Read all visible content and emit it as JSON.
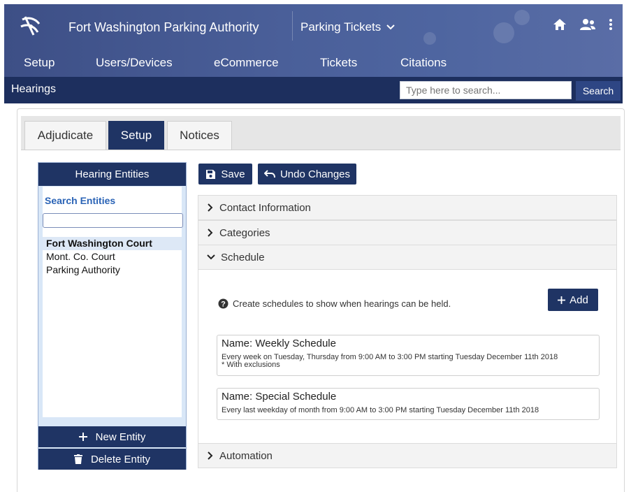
{
  "header": {
    "app_title": "Fort Washington Parking Authority",
    "module": "Parking Tickets",
    "icons": [
      "home-icon",
      "users-icon",
      "more-vertical-icon"
    ],
    "nav": [
      "Setup",
      "Users/Devices",
      "eCommerce",
      "Tickets",
      "Citations"
    ]
  },
  "subbar": {
    "title": "Hearings",
    "search_placeholder": "Type here to search...",
    "search_button": "Search"
  },
  "tabs": [
    "Adjudicate",
    "Setup",
    "Notices"
  ],
  "active_tab": "Setup",
  "entities": {
    "title": "Hearing Entities",
    "search_label": "Search Entities",
    "search_value": "",
    "items": [
      "Fort Washington Court",
      "Mont. Co. Court",
      "Parking Authority"
    ],
    "selected": "Fort Washington Court",
    "new_button": "New Entity",
    "delete_button": "Delete Entity"
  },
  "toolbar": {
    "save_label": "Save",
    "undo_label": "Undo Changes"
  },
  "sections": {
    "contact": "Contact Information",
    "categories": "Categories",
    "schedule": "Schedule",
    "automation": "Automation"
  },
  "schedule": {
    "hint": "Create schedules to show when hearings can be held.",
    "add_label": "Add",
    "items": [
      {
        "name": "Name: Weekly Schedule",
        "desc": "Every week on Tuesday, Thursday from 9:00 AM to 3:00 PM starting Tuesday December 11th 2018",
        "note": "* With exclusions"
      },
      {
        "name": "Name: Special Schedule",
        "desc": "Every last weekday of month from 9:00 AM to 3:00 PM starting Tuesday December 11th 2018",
        "note": ""
      }
    ]
  },
  "colors": {
    "header_blue": "#4a5f99",
    "navy": "#1f3464",
    "link_blue": "#2a63b6"
  }
}
